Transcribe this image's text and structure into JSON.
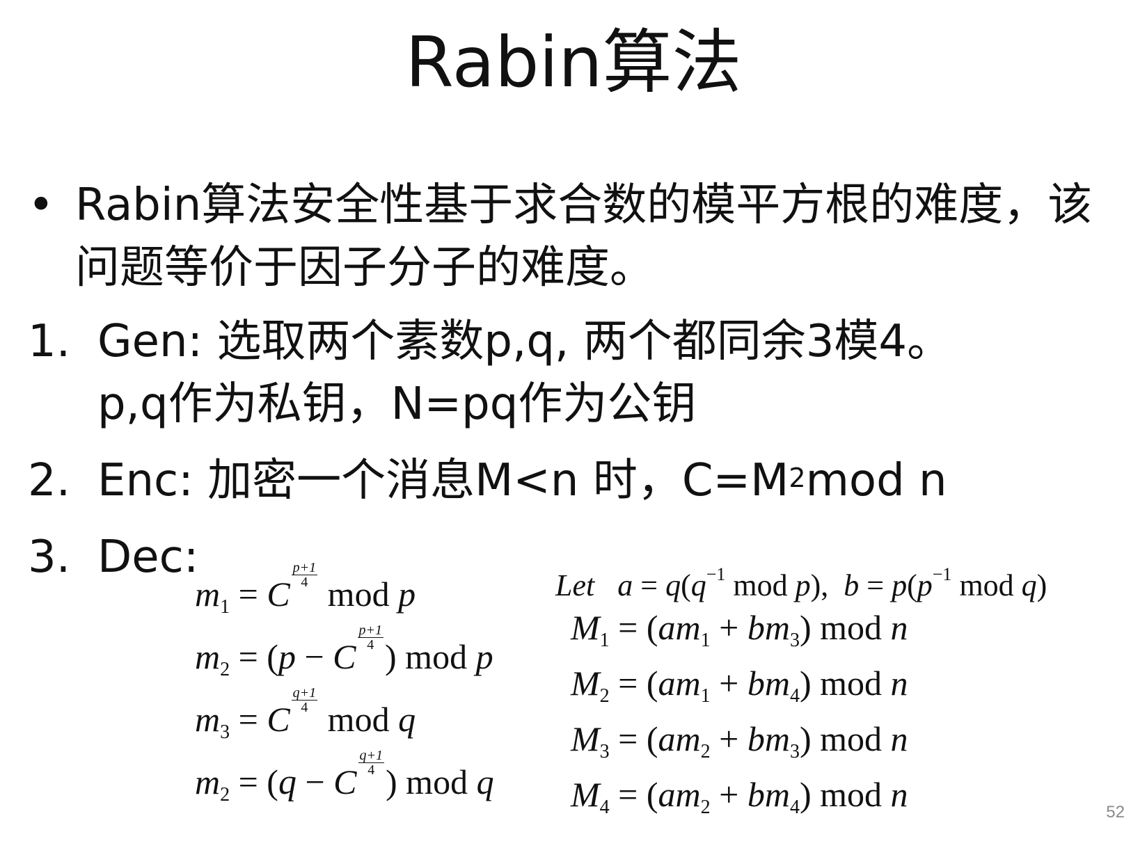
{
  "slide": {
    "title": "Rabin算法",
    "bullet": {
      "symbol": "•",
      "text": "Rabin算法安全性基于求合数的模平方根的难度，该问题等价于因子分子的难度。"
    },
    "items": [
      {
        "number": "1.",
        "line1": "Gen:  选取两个素数p,q, 两个都同余3模4。",
        "line2": "p,q作为私钥，N=pq作为公钥"
      },
      {
        "number": "2.",
        "text_before": "Enc: 加密一个消息M<n 时，C=M",
        "superscript": "2",
        "text_after": "mod n"
      },
      {
        "number": "3.",
        "text": "Dec:"
      }
    ],
    "page_number": "52"
  }
}
